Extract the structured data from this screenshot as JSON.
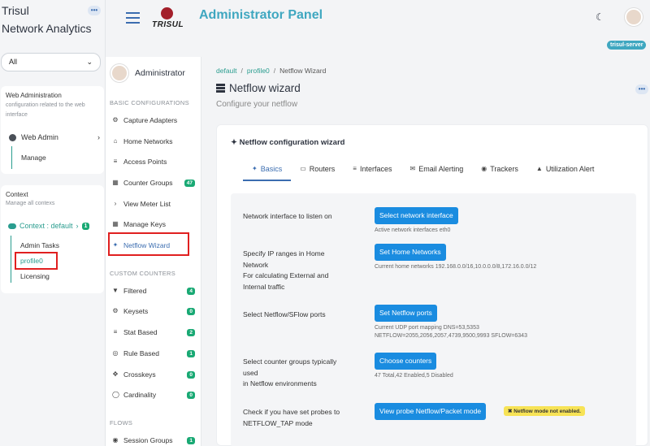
{
  "app": {
    "brand_line1": "Trisul",
    "brand_line2": "Network Analytics",
    "more_label": "•••",
    "context_select": "All",
    "web_admin": {
      "title": "Web Administration",
      "subtitle": "configuration related to the web interface",
      "item": "Web Admin",
      "sub_item": "Manage"
    },
    "context": {
      "title": "Context",
      "subtitle": "Manage all contexs",
      "current_label": "Context : default",
      "current_count": "1",
      "items": [
        "Admin Tasks",
        "profile0",
        "Licensing"
      ]
    }
  },
  "header": {
    "logo_text": "TRISUL",
    "title": "Administrator Panel",
    "server_badge": "trisul-server"
  },
  "nav": {
    "user": "Administrator",
    "basic_heading": "BASIC CONFIGURATIONS",
    "basic_items": [
      {
        "label": "Capture Adapters",
        "icon": "gear-icon"
      },
      {
        "label": "Home Networks",
        "icon": "home-icon"
      },
      {
        "label": "Access Points",
        "icon": "signal-icon"
      },
      {
        "label": "Counter Groups",
        "icon": "cubes-icon",
        "count": "47"
      },
      {
        "label": "View Meter List",
        "icon": "chevron-right-icon"
      },
      {
        "label": "Manage Keys",
        "icon": "table-icon"
      },
      {
        "label": "Netflow Wizard",
        "icon": "magic-wand-icon"
      }
    ],
    "custom_heading": "CUSTOM COUNTERS",
    "custom_items": [
      {
        "label": "Filtered",
        "icon": "filter-icon",
        "count": "4"
      },
      {
        "label": "Keysets",
        "icon": "cogs-icon",
        "count": "0"
      },
      {
        "label": "Stat Based",
        "icon": "list-icon",
        "count": "2"
      },
      {
        "label": "Rule Based",
        "icon": "target-icon",
        "count": "1"
      },
      {
        "label": "Crosskeys",
        "icon": "crosshair-icon",
        "count": "0"
      },
      {
        "label": "Cardinality",
        "icon": "circle-icon",
        "count": "0"
      }
    ],
    "flows_heading": "FLOWS",
    "flows_items": [
      {
        "label": "Session Groups",
        "icon": "eye-icon",
        "count": "1"
      }
    ]
  },
  "breadcrumb": [
    "default",
    "profile0",
    "Netflow Wizard"
  ],
  "page": {
    "title": "Netflow wizard",
    "subtitle": "Configure your netflow"
  },
  "wizard": {
    "title": "Netflow configuration wizard",
    "tabs": [
      {
        "label": "Basics",
        "icon": "magic-wand-icon"
      },
      {
        "label": "Routers",
        "icon": "router-icon"
      },
      {
        "label": "Interfaces",
        "icon": "list-icon"
      },
      {
        "label": "Email Alerting",
        "icon": "envelope-icon"
      },
      {
        "label": "Trackers",
        "icon": "eye-icon"
      },
      {
        "label": "Utilization Alert",
        "icon": "bell-icon"
      }
    ],
    "rows": [
      {
        "question": "Network interface to listen on",
        "button": "Select network interface",
        "hint": "Active network interfaces eth0"
      },
      {
        "question_lines": [
          "Specify IP ranges in Home",
          "Network",
          "For calculating External and",
          "Internal traffic"
        ],
        "button": "Set Home Networks",
        "hint": "Current home networks 192.168.0.0/16,10.0.0.0/8,172.16.0.0/12"
      },
      {
        "question": "Select Netflow/SFlow ports",
        "button": "Set Netflow ports",
        "hint_lines": [
          "Current UDP port mapping DNS=53,5353",
          "NETFLOW=2055,2056,2057,4739,9500,9993 SFLOW=6343"
        ]
      },
      {
        "question_lines": [
          "Select counter groups typically",
          "used",
          "in Netflow environments"
        ],
        "button": "Choose counters",
        "hint": "47 Total,42 Enabled,5 Disabled"
      },
      {
        "question_lines": [
          "Check if you have set probes to",
          "NETFLOW_TAP mode"
        ],
        "button": "View probe Netflow/Packet mode",
        "warning": "Netflow mode not enabled."
      }
    ]
  }
}
